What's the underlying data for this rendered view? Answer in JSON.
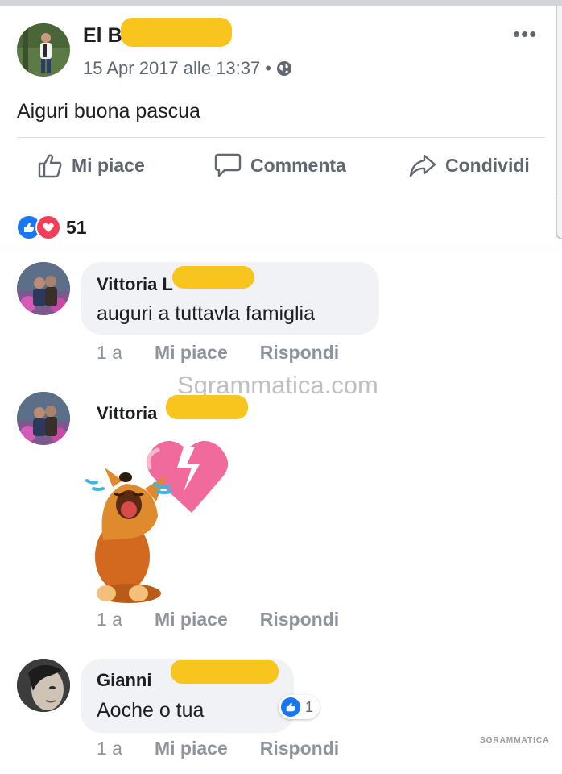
{
  "post": {
    "author": "El B",
    "timestamp": "15 Apr 2017 alle 13:37 •",
    "privacy_icon": "globe-icon",
    "more_label": "•••",
    "text": "Aiguri buona pascua"
  },
  "actions": {
    "like": "Mi piace",
    "comment": "Commenta",
    "share": "Condividi"
  },
  "reactions": {
    "types": [
      "like",
      "love"
    ],
    "count": "51"
  },
  "comments": [
    {
      "name": "Vittoria L",
      "text": "auguri a tuttavla famiglia",
      "time": "1 a",
      "like": "Mi piace",
      "reply": "Rispondi"
    },
    {
      "name": "Vittoria",
      "text": "",
      "sticker": "crying-fox-broken-heart",
      "time": "1 a",
      "like": "Mi piace",
      "reply": "Rispondi"
    },
    {
      "name": "Gianni",
      "text": "Aoche o tua",
      "time": "1 a",
      "like": "Mi piace",
      "reply": "Rispondi",
      "like_count": "1"
    }
  ],
  "watermark": {
    "main": "Sgrammatica.com",
    "small": "SGRAMMATICA"
  },
  "colors": {
    "like_blue": "#1877f2",
    "love_red": "#f33e58",
    "redaction": "#f8c51f",
    "bubble": "#f0f2f5",
    "muted_text": "#606770"
  }
}
